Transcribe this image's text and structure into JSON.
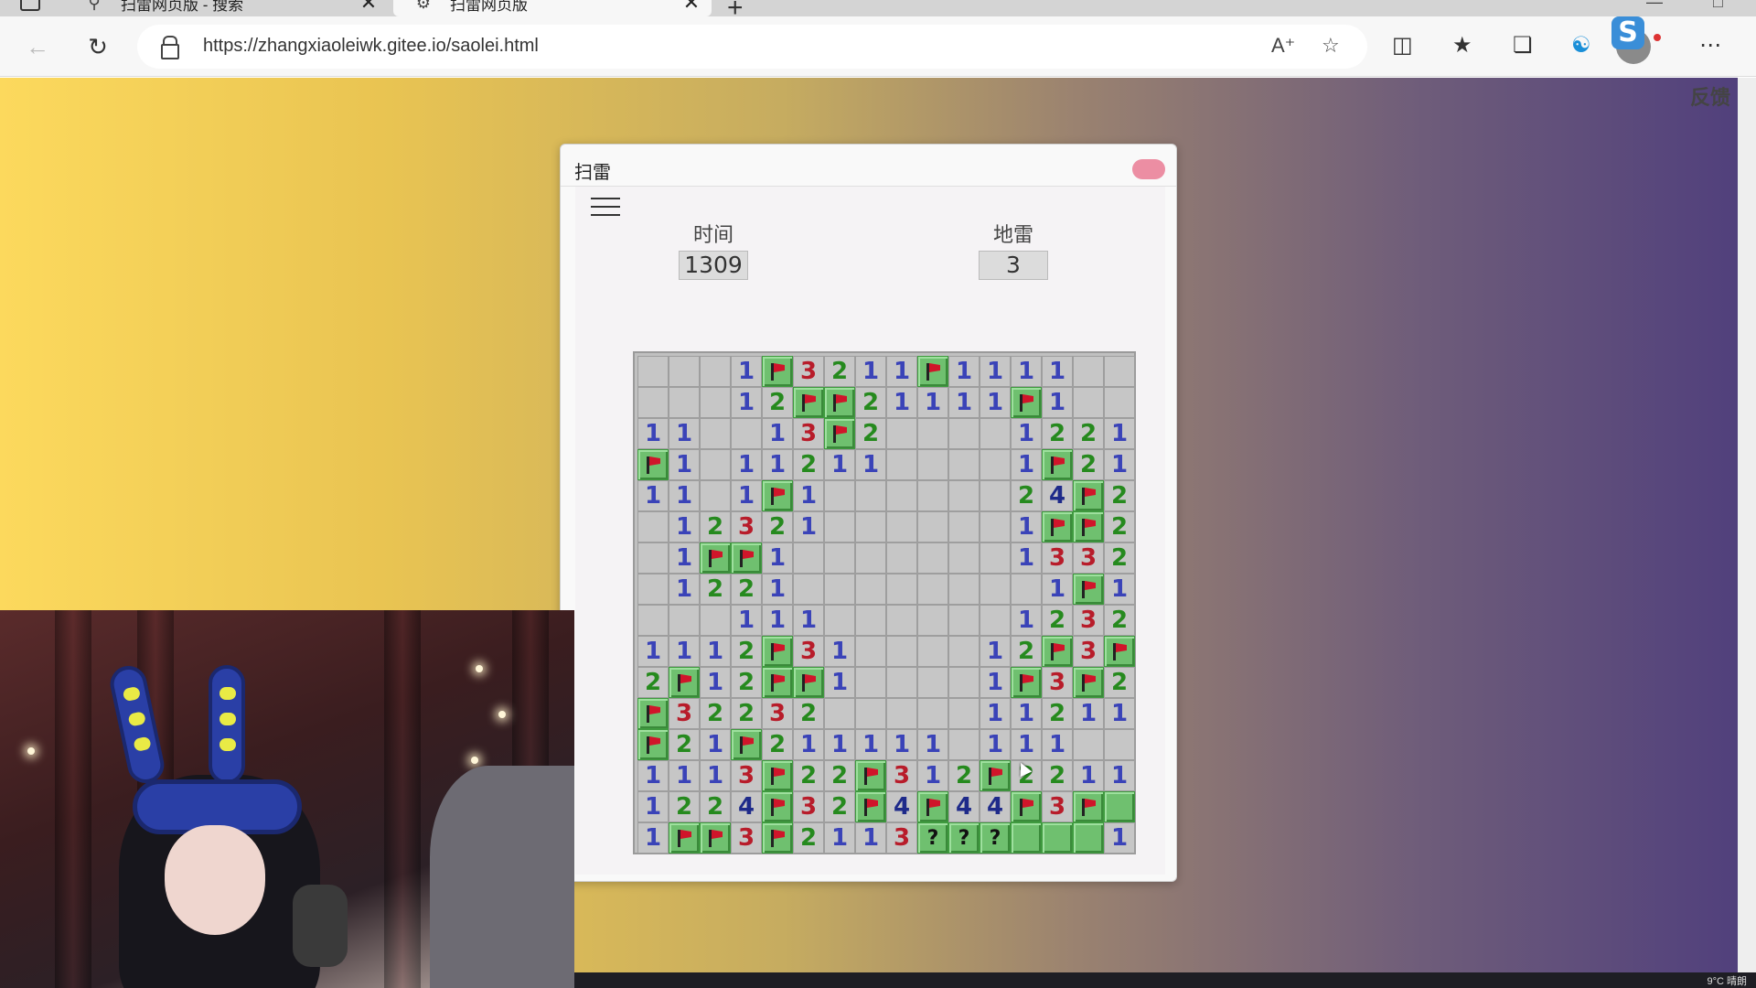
{
  "browser": {
    "tabs": [
      {
        "title": "扫雷网页版 - 搜索",
        "icon": "search-icon",
        "active": false
      },
      {
        "title": "扫雷网页版",
        "icon": "gear-icon",
        "active": true
      }
    ],
    "url": "https://zhangxiaoleiwk.gitee.io/saolei.html"
  },
  "page": {
    "feedback": "反馈"
  },
  "game": {
    "window_title": "扫雷",
    "time_label": "时间",
    "time_value": "1309",
    "mines_label": "地雷",
    "mines_value": "3",
    "board": [
      "...1F3211F1111..",
      "...12FF21111F1..",
      "11..13F2....1221",
      "F1.11211....1F21",
      "11.1F1......24F2",
      ".12321......1FF2",
      ".1FF1.......1332",
      ".1221........1F1",
      "...111......1232",
      "1112F31....12F3F",
      "2F12FF1....1F3F2",
      "F32232.....11211",
      "F21F211111.111..",
      "1113F22F312F2211",
      "1224F32F4F44F3FH",
      "1FF3F2113???HHH1"
    ]
  },
  "taskbar": {
    "tray_text": "9°C 晴朗"
  }
}
